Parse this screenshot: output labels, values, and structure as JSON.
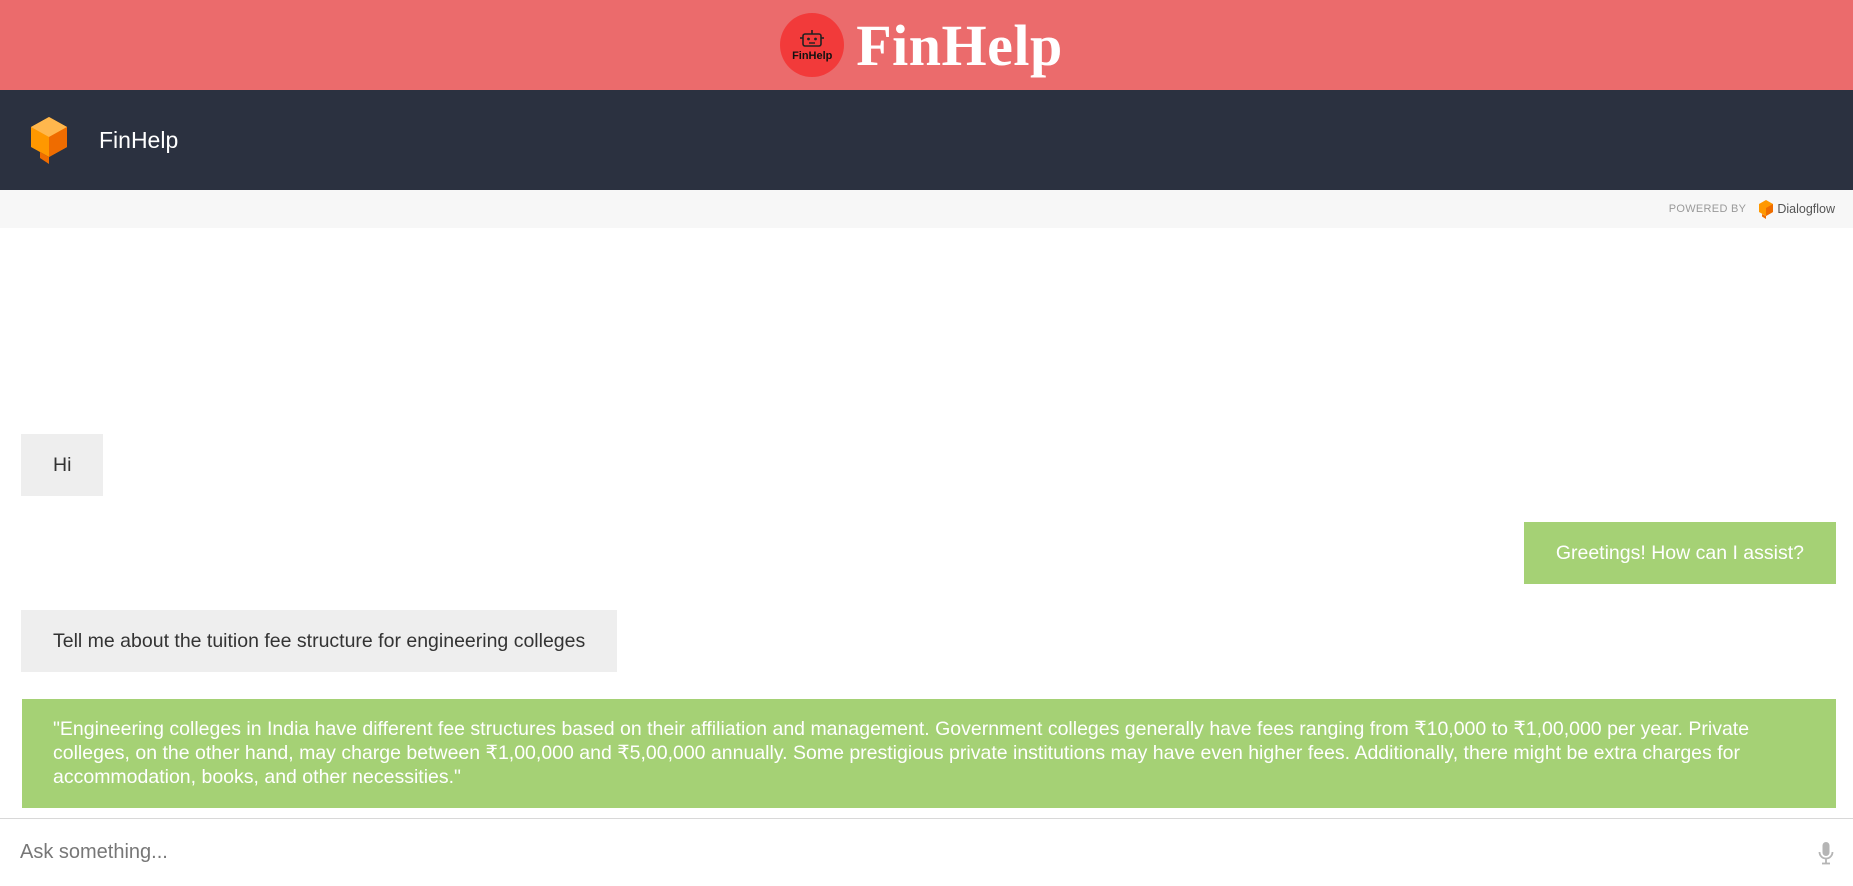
{
  "banner": {
    "logo_text": "FinHelp",
    "title": "FinHelp"
  },
  "header": {
    "agent_name": "FinHelp",
    "icon": "dialogflow-agent-icon"
  },
  "powered_by": {
    "label": "POWERED BY",
    "brand": "Dialogflow"
  },
  "messages": [
    {
      "sender": "user",
      "text": "Hi"
    },
    {
      "sender": "bot",
      "text": "Greetings! How can I assist?"
    },
    {
      "sender": "user",
      "text": "Tell me about the tuition fee structure for engineering colleges"
    },
    {
      "sender": "bot",
      "text": "\"Engineering colleges in India have different fee structures based on their affiliation and management. Government colleges generally have fees ranging from ₹10,000 to ₹1,00,000 per year. Private colleges, on the other hand, may charge between ₹1,00,000 and ₹5,00,000 annually. Some prestigious private institutions may have even higher fees. Additionally, there might be extra charges for accommodation, books, and other necessities.\""
    }
  ],
  "input": {
    "placeholder": "Ask something...",
    "value": ""
  },
  "colors": {
    "banner": "#eb6b6c",
    "header": "#2b3140",
    "user_bubble": "#eeeeee",
    "bot_bubble": "#a5d175",
    "accent": "#ff8c00"
  }
}
